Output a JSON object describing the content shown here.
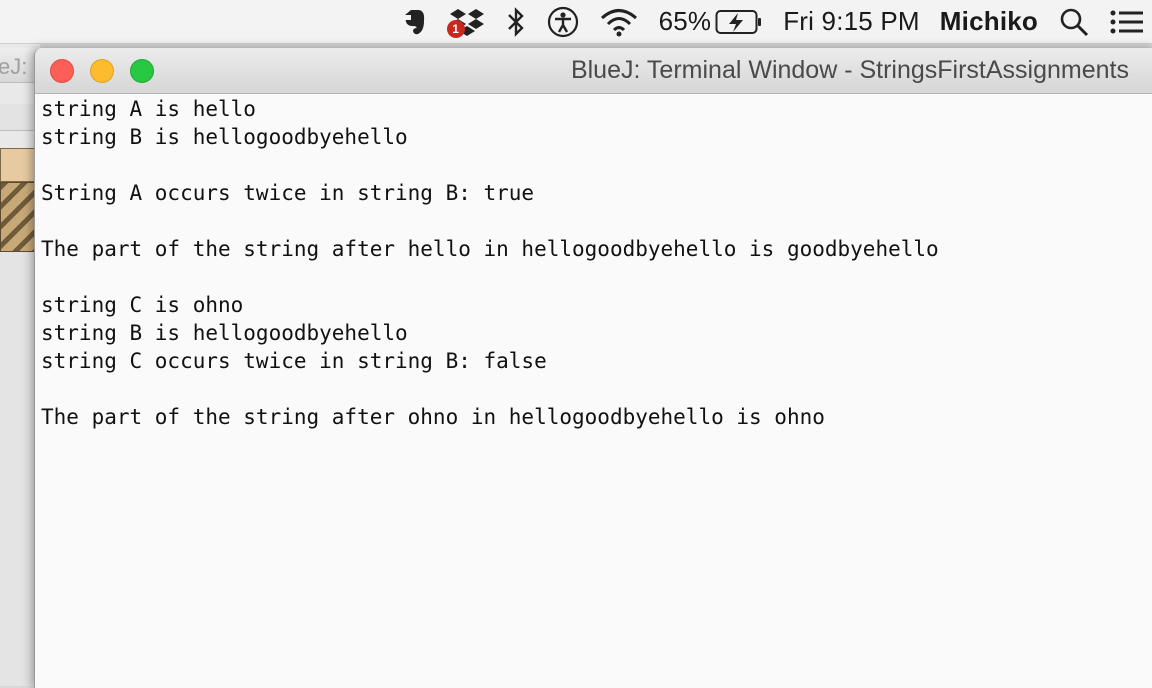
{
  "menubar": {
    "battery_percent": "65%",
    "clock": "Fri 9:15 PM",
    "user": "Michiko",
    "dropbox_badge": "1",
    "icons": [
      "evernote-icon",
      "dropbox-icon",
      "bluetooth-icon",
      "accessibility-icon",
      "wifi-icon",
      "battery-icon",
      "search-icon",
      "list-icon"
    ]
  },
  "background_window": {
    "title_fragment": "eJ:"
  },
  "terminal": {
    "title": "BlueJ: Terminal Window - StringsFirstAssignments",
    "lines": [
      "string A is hello",
      "string B is hellogoodbyehello",
      "",
      "String A occurs twice in string B: true",
      "",
      "The part of the string after hello in hellogoodbyehello is goodbyehello",
      "",
      "string C is ohno",
      "string B is hellogoodbyehello",
      "string C occurs twice in string B: false",
      "",
      "The part of the string after ohno in hellogoodbyehello is ohno"
    ]
  },
  "colors": {
    "close": "#fc5f57",
    "minimize": "#fdbc2e",
    "maximize": "#28c840",
    "badge": "#c9281e"
  }
}
